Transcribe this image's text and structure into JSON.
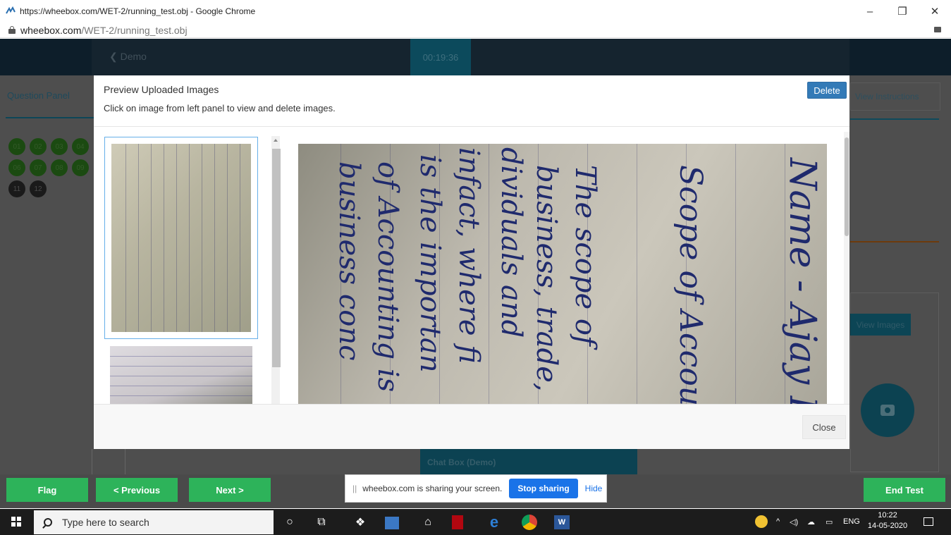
{
  "browser": {
    "window_title": "https://wheebox.com/WET-2/running_test.obj - Google Chrome",
    "url_host": "wheebox.com",
    "url_path": "/WET-2/running_test.obj",
    "controls": {
      "minimize": "–",
      "restore": "❐",
      "close": "✕"
    }
  },
  "app": {
    "back_label": "❮  Demo",
    "timer": "00:19:36",
    "question_panel_label": "Question Panel",
    "questions": [
      "01",
      "02",
      "03",
      "04",
      "06",
      "07",
      "08",
      "09",
      "11",
      "12"
    ],
    "view_instructions_label": "View Instructions",
    "view_images_label": "View Images",
    "chat_box_label": "Chat Box (Demo)"
  },
  "modal": {
    "title": "Preview Uploaded Images",
    "subtitle": "Click on image from left panel to view and delete images.",
    "delete_label": "Delete",
    "close_label": "Close",
    "handwriting_lines": [
      "Name - Ajay Ku",
      "Scope of Accou",
      "The scope of",
      "business, trade,",
      "dividuals and",
      "infact, where fi",
      "is the importan",
      "of Accounting is",
      "business conc"
    ]
  },
  "nav": {
    "flag_label": "Flag",
    "previous_label": "< Previous",
    "next_label": "Next >",
    "end_test_label": "End Test"
  },
  "share": {
    "grip": "||",
    "message": "wheebox.com is sharing your screen.",
    "stop_label": "Stop sharing",
    "hide_label": "Hide"
  },
  "taskbar": {
    "search_placeholder": "Type here to search",
    "language": "ENG",
    "time": "10:22",
    "date": "14-05-2020"
  },
  "colors": {
    "accent_green": "#2db35a",
    "primary_blue": "#337ab7",
    "share_blue": "#1a73e8"
  }
}
